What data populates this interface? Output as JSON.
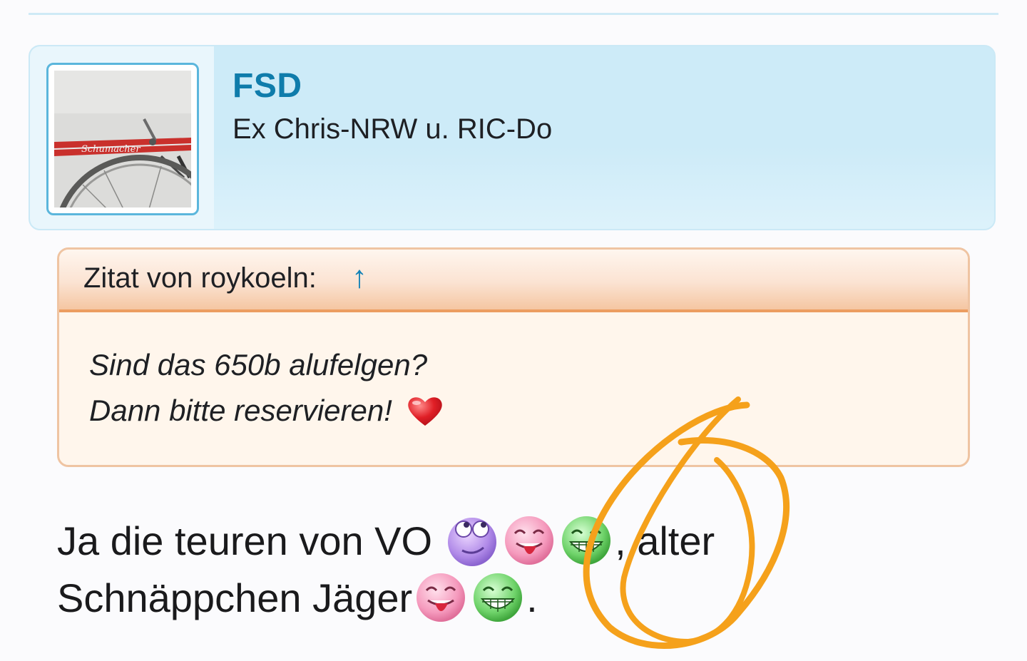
{
  "post": {
    "username": "FSD",
    "user_title": "Ex Chris-NRW u. RIC-Do",
    "avatar_icon": "bicycle-photo-icon",
    "header_color": "#cdebf8",
    "username_color": "#0f7cab"
  },
  "quote": {
    "author_label": "Zitat von roykoeln:",
    "link_arrow": "↑",
    "lines": [
      "Sind das 650b alufelgen?",
      "Dann bitte reservieren!"
    ],
    "trailing_icon": "red-heart-icon",
    "border_color": "#efc4a2",
    "header_underline_color": "#ec9d60"
  },
  "message": {
    "line1_text": "Ja die teuren von VO",
    "line1_suffix": ", alter",
    "line2_text": "Schnäppchen Jäger",
    "line2_suffix": ".",
    "line1_icons": [
      "eye-roll-smiley-icon",
      "tongue-out-smiley-icon",
      "grinning-smiley-icon"
    ],
    "line2_icons": [
      "tongue-out-smiley-icon",
      "grinning-smiley-icon"
    ]
  },
  "annotation": {
    "type": "hand-drawn-circle",
    "color": "#f5a11b"
  }
}
